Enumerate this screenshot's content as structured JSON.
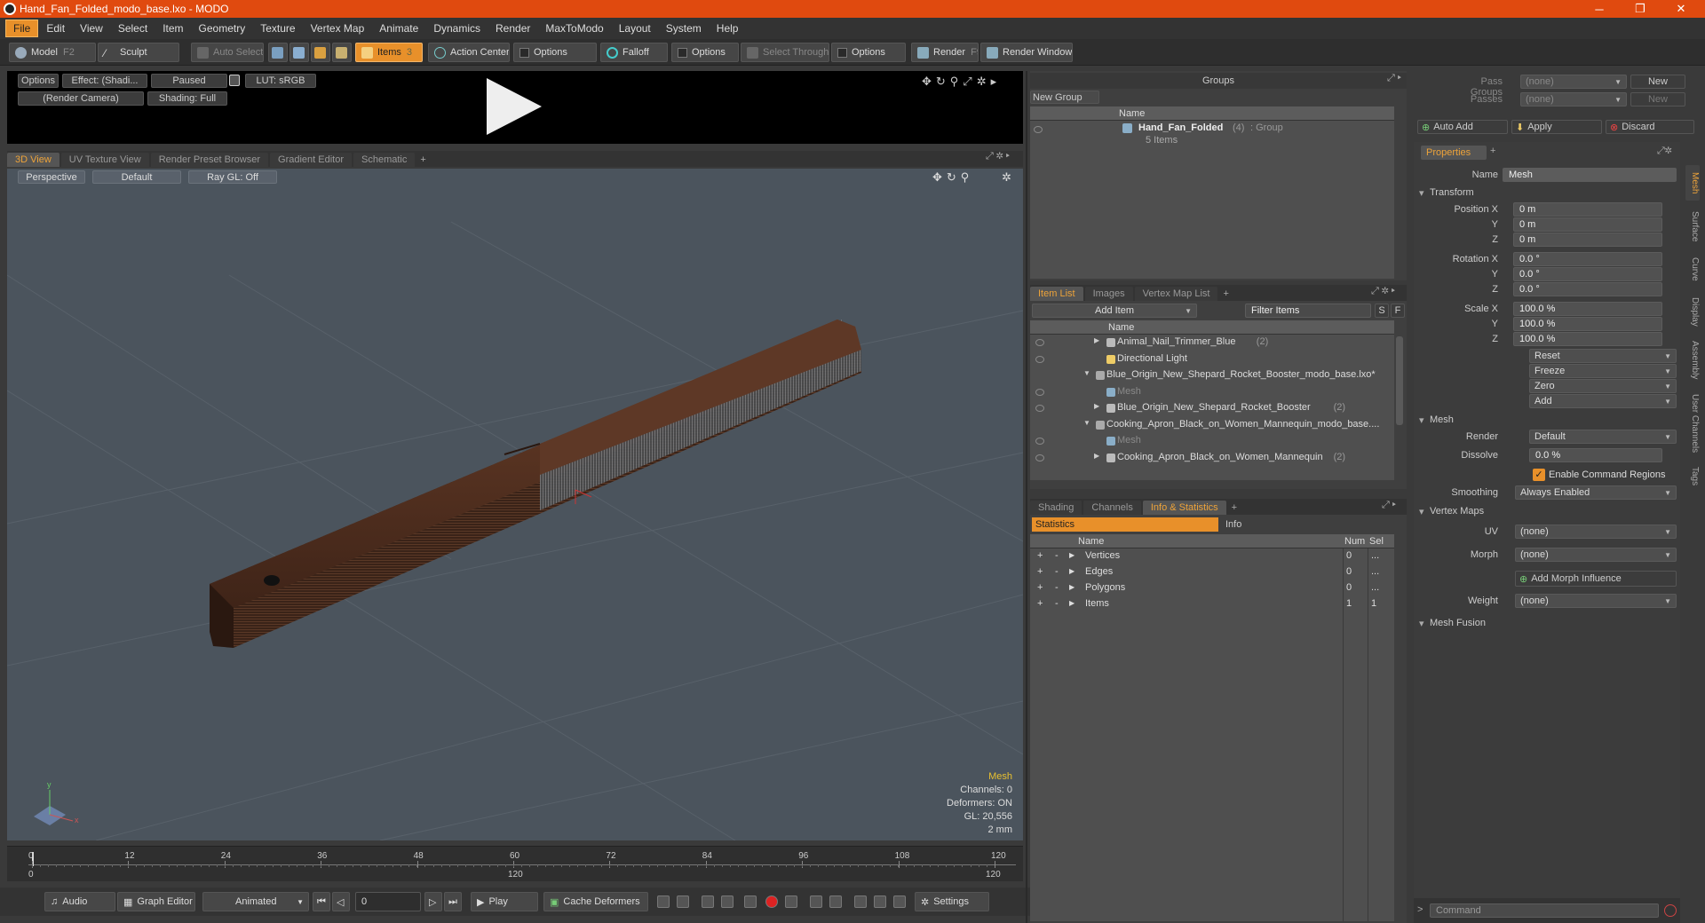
{
  "window": {
    "title": "Hand_Fan_Folded_modo_base.lxo - MODO",
    "min": "─",
    "max": "❐",
    "close": "✕"
  },
  "menu": [
    "File",
    "Edit",
    "View",
    "Select",
    "Item",
    "Geometry",
    "Texture",
    "Vertex Map",
    "Animate",
    "Dynamics",
    "Render",
    "MaxToModo",
    "Layout",
    "System",
    "Help"
  ],
  "toolbar": {
    "model": "Model",
    "model_key": "F2",
    "sculpt": "Sculpt",
    "auto_select": "Auto Select",
    "items": "Items",
    "items_key": "3",
    "action_center": "Action Center",
    "options1": "Options",
    "falloff": "Falloff",
    "options2": "Options",
    "select_through": "Select Through",
    "options3": "Options",
    "render": "Render",
    "render_key": "F9",
    "render_window": "Render Window"
  },
  "preview": {
    "options": "Options",
    "effect": "Effect: (Shadi...",
    "paused": "Paused",
    "lut": "LUT: sRGB",
    "camera": "(Render Camera)",
    "shading": "Shading: Full"
  },
  "view_tabs": [
    "3D View",
    "UV Texture View",
    "Render Preset Browser",
    "Gradient Editor",
    "Schematic",
    "+"
  ],
  "viewport": {
    "perspective": "Perspective",
    "default": "Default",
    "raygl": "Ray GL: Off",
    "hud": {
      "type": "Mesh",
      "channels": "Channels: 0",
      "deformers": "Deformers: ON",
      "gl": "GL: 20,556",
      "scale": "2 mm"
    }
  },
  "timeline": {
    "ticks_top": [
      "0",
      "12",
      "24",
      "36",
      "48",
      "60",
      "72",
      "84",
      "96",
      "108",
      "120"
    ],
    "left_low": "0",
    "mid_low": "120",
    "right_low": "120"
  },
  "bottombar": {
    "audio": "Audio",
    "graph_editor": "Graph Editor",
    "animated": "Animated",
    "frame": "0",
    "play": "Play",
    "cache_deformers": "Cache Deformers",
    "settings": "Settings"
  },
  "groups": {
    "title": "Groups",
    "new_group": "New Group",
    "col_name": "Name",
    "group_name": "Hand_Fan_Folded",
    "group_count": "(4)",
    "group_type": ": Group",
    "group_items": "5 Items"
  },
  "pass_groups": {
    "pass_groups_label": "Pass Groups",
    "pass_groups_val": "(none)",
    "passes_label": "Passes",
    "passes_val": "(none)",
    "new1": "New",
    "new2": "New",
    "auto_add": "Auto Add",
    "apply": "Apply",
    "discard": "Discard"
  },
  "item_tabs": [
    "Item List",
    "Images",
    "Vertex Map List",
    "+"
  ],
  "item_list": {
    "add_item": "Add Item",
    "filter": "Filter Items",
    "s": "S",
    "f": "F",
    "col_name": "Name",
    "rows": [
      {
        "text": "Animal_Nail_Trimmer_Blue",
        "count": "(2)"
      },
      {
        "text": "Directional Light",
        "count": ""
      },
      {
        "text": "Blue_Origin_New_Shepard_Rocket_Booster_modo_base.lxo*",
        "count": ""
      },
      {
        "text": "Mesh",
        "count": ""
      },
      {
        "text": "Blue_Origin_New_Shepard_Rocket_Booster",
        "count": "(2)"
      },
      {
        "text": "Cooking_Apron_Black_on_Women_Mannequin_modo_base....",
        "count": ""
      },
      {
        "text": "Mesh",
        "count": ""
      },
      {
        "text": "Cooking_Apron_Black_on_Women_Mannequin",
        "count": "(2)"
      }
    ]
  },
  "stats_tabs": [
    "Shading",
    "Channels",
    "Info & Statistics",
    "+"
  ],
  "stats": {
    "statistics": "Statistics",
    "info": "Info",
    "col_name": "Name",
    "col_num": "Num",
    "col_sel": "Sel",
    "rows": [
      {
        "name": "Vertices",
        "num": "0",
        "sel": "..."
      },
      {
        "name": "Edges",
        "num": "0",
        "sel": "..."
      },
      {
        "name": "Polygons",
        "num": "0",
        "sel": "..."
      },
      {
        "name": "Items",
        "num": "1",
        "sel": "1"
      }
    ]
  },
  "properties": {
    "tab": "Properties",
    "name_label": "Name",
    "name_val": "Mesh",
    "transform": "Transform",
    "pos_x_label": "Position X",
    "pos_x": "0 m",
    "pos_y": "0 m",
    "pos_z": "0 m",
    "rot_x_label": "Rotation X",
    "rot_x": "0.0 °",
    "rot_y": "0.0 °",
    "rot_z": "0.0 °",
    "scl_x_label": "Scale X",
    "scl_x": "100.0 %",
    "scl_y": "100.0 %",
    "scl_z": "100.0 %",
    "y": "Y",
    "z": "Z",
    "reset": "Reset",
    "freeze": "Freeze",
    "zero": "Zero",
    "add": "Add",
    "mesh": "Mesh",
    "render_label": "Render",
    "render_val": "Default",
    "dissolve_label": "Dissolve",
    "dissolve_val": "0.0 %",
    "enable_cmd": "Enable Command Regions",
    "smoothing_label": "Smoothing",
    "smoothing_val": "Always Enabled",
    "vertex_maps": "Vertex Maps",
    "uv_label": "UV",
    "uv_val": "(none)",
    "morph_label": "Morph",
    "morph_val": "(none)",
    "add_morph": "Add Morph Influence",
    "weight_label": "Weight",
    "weight_val": "(none)",
    "mesh_fusion": "Mesh Fusion",
    "command": "Command"
  },
  "side_tabs": [
    "Mesh",
    "Surface",
    "Curve",
    "Display",
    "Assembly",
    "User Channels",
    "Tags"
  ],
  "colors": {
    "accent": "#e8902a",
    "title": "#e04a0f",
    "wood": "#4a2a1c"
  }
}
